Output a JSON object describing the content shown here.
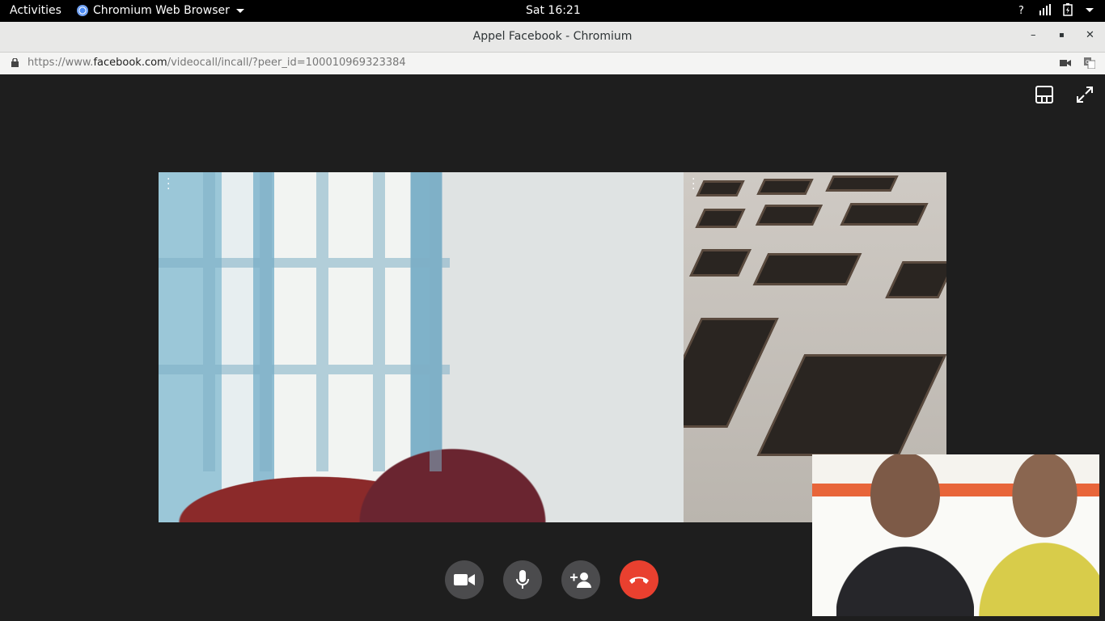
{
  "system_bar": {
    "activities": "Activities",
    "app_name": "Chromium Web Browser",
    "clock": "Sat 16:21"
  },
  "window": {
    "title": "Appel Facebook - Chromium",
    "minimize": "–",
    "maximize": "▪",
    "close": "✕"
  },
  "address_bar": {
    "url_prefix": "https://www.",
    "url_domain": "facebook.com",
    "url_path": "/videocall/incall/?peer_id=100010969323384"
  },
  "call": {
    "controls": [
      {
        "name": "camera",
        "icon": "video-camera-icon"
      },
      {
        "name": "microphone",
        "icon": "microphone-icon"
      },
      {
        "name": "add-person",
        "icon": "add-person-icon"
      },
      {
        "name": "end-call",
        "icon": "hang-up-icon",
        "color": "#e9402f"
      }
    ],
    "top_right_icons": [
      "layout-icon",
      "fullscreen-icon"
    ]
  },
  "colors": {
    "background": "#1e1e1e",
    "control_button": "#4b4b4d",
    "end_call": "#e9402f"
  }
}
